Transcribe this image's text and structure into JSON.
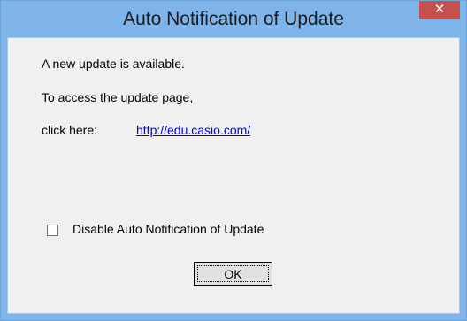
{
  "window": {
    "title": "Auto Notification of Update",
    "close_label": "✕"
  },
  "dialog": {
    "message": "A new update is available.",
    "access_text": "To access the update page,",
    "click_here_text": "click here:",
    "link_text": "http://edu.casio.com/",
    "checkbox_label": "Disable Auto Notification of Update",
    "checkbox_checked": false,
    "ok_label": "OK"
  }
}
